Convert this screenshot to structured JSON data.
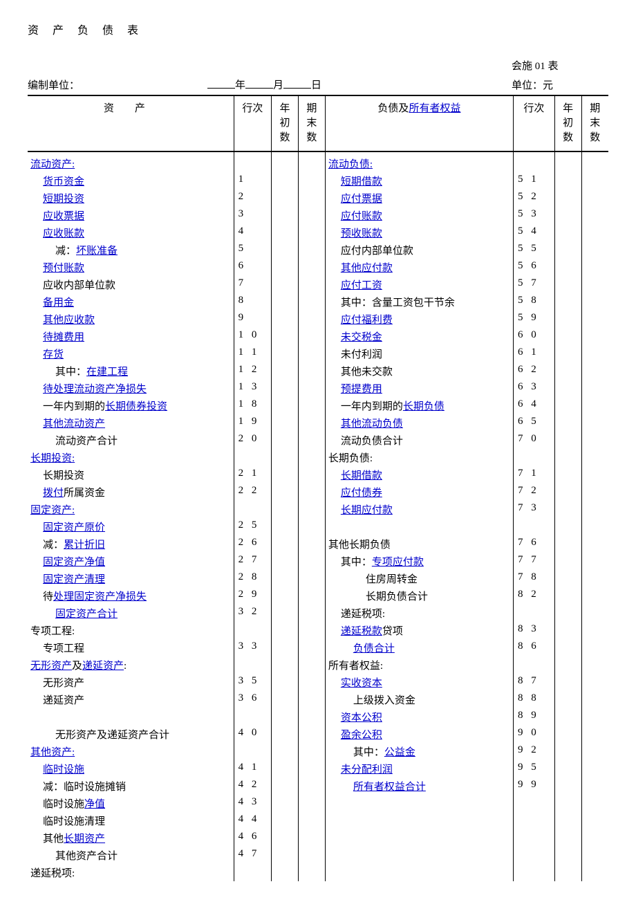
{
  "title": "资 产 负 债 表",
  "form_code": "会施 01 表",
  "org_label": "编制单位：",
  "date_year": "年",
  "date_month": "月",
  "date_day": "日",
  "unit_label": "单位：元",
  "headers": {
    "asset": "资产",
    "line": "行次",
    "begin": "年初数",
    "end": "期末数",
    "liab": "负债及",
    "owner": "所有者权益"
  },
  "rows": [
    {
      "al": "流动资产:",
      "alink": 1,
      "ln": "",
      "bl": "流动负债:",
      "blink": 1,
      "rn": ""
    },
    {
      "ai": 1,
      "al": "货币资金",
      "alink": 1,
      "ln": "1",
      "bi": 1,
      "bl": "短期借款",
      "blink": 1,
      "rn": "51"
    },
    {
      "ai": 1,
      "al": "短期投资",
      "alink": 1,
      "ln": "2",
      "bi": 1,
      "bl": "应付票据",
      "blink": 1,
      "rn": "52"
    },
    {
      "ai": 1,
      "al": "应收票据",
      "alink": 1,
      "ln": "3",
      "bi": 1,
      "bl": "应付账款",
      "blink": 1,
      "rn": "53"
    },
    {
      "ai": 1,
      "al": "应收账款",
      "alink": 1,
      "ln": "4",
      "bi": 1,
      "bl": "预收账款",
      "blink": 1,
      "rn": "54"
    },
    {
      "ai": 2,
      "ap": "减：",
      "al": "坏账准备",
      "alink": 1,
      "ln": "5",
      "bi": 1,
      "bl": "应付内部单位款",
      "rn": "55"
    },
    {
      "ai": 1,
      "al": "预付账款",
      "alink": 1,
      "ln": "6",
      "bi": 1,
      "bl": "其他应付款",
      "blink": 1,
      "rn": "56"
    },
    {
      "ai": 1,
      "al": "应收内部单位款",
      "ln": "7",
      "bi": 1,
      "bl": "应付工资",
      "blink": 1,
      "rn": "57"
    },
    {
      "ai": 1,
      "al": "备用金",
      "alink": 1,
      "ln": "8",
      "bi": 1,
      "bl": "其中：含量工资包干节余",
      "rn": "58"
    },
    {
      "ai": 1,
      "al": "其他应收款",
      "alink": 1,
      "ln": "9",
      "bi": 1,
      "bl": "应付福利费",
      "blink": 1,
      "rn": "59"
    },
    {
      "ai": 1,
      "al": "待摊费用",
      "alink": 1,
      "ln": "10",
      "bi": 1,
      "bl": "未交税金",
      "blink": 1,
      "rn": "60"
    },
    {
      "ai": 1,
      "al": "存货",
      "alink": 1,
      "ln": "11",
      "bi": 1,
      "bl": "未付利润",
      "rn": "61"
    },
    {
      "ai": 2,
      "ap": "其中：",
      "al": "在建工程",
      "alink": 1,
      "ln": "12",
      "bi": 1,
      "bl": "其他未交款",
      "rn": "62"
    },
    {
      "ai": 1,
      "al": "待处理流动资产净损失",
      "alink": 1,
      "ln": "13",
      "bi": 1,
      "bl": "预提费用",
      "blink": 1,
      "rn": "63"
    },
    {
      "ai": 1,
      "ap": "一年内到期的",
      "al": "长期债券投资",
      "alink": 1,
      "ln": "18",
      "bi": 1,
      "bp": "一年内到期的",
      "bl": "长期负债",
      "blink": 1,
      "rn": "64"
    },
    {
      "ai": 1,
      "al": "其他流动资产",
      "alink": 1,
      "ln": "19",
      "bi": 1,
      "bl": "其他流动负债",
      "blink": 1,
      "rn": "65"
    },
    {
      "ai": 2,
      "al": "流动资产合计",
      "ln": "20",
      "bi": 1,
      "bl": "流动负债合计",
      "rn": "70"
    },
    {
      "al": "长期投资:",
      "alink": 1,
      "ln": "",
      "bl": "长期负债:",
      "rn": ""
    },
    {
      "ai": 1,
      "al": "长期投资",
      "ln": "21",
      "bi": 1,
      "bl": "长期借款",
      "blink": 1,
      "rn": "71"
    },
    {
      "ai": 1,
      "al": "拨付",
      "alink": 1,
      "as": "所属资金",
      "ln": "22",
      "bi": 1,
      "bl": "应付债券",
      "blink": 1,
      "rn": "72"
    },
    {
      "al": "固定资产:",
      "alink": 1,
      "ln": "",
      "bi": 1,
      "bl": "长期应付款",
      "blink": 1,
      "rn": "73"
    },
    {
      "ai": 1,
      "al": "固定资产原价",
      "alink": 1,
      "ln": "25",
      "bl": "",
      "rn": ""
    },
    {
      "ai": 1,
      "ap": "减：",
      "al": "累计折旧",
      "alink": 1,
      "ln": "26",
      "bl": "其他长期负债",
      "rn": "76"
    },
    {
      "ai": 1,
      "al": "固定资产净值",
      "alink": 1,
      "ln": "27",
      "bi": 1,
      "bp": "其中：",
      "bl": "专项应付款",
      "blink": 1,
      "rn": "77"
    },
    {
      "ai": 1,
      "al": "固定资产清理",
      "alink": 1,
      "ln": "28",
      "bi": 3,
      "bl": "住房周转金",
      "rn": "78"
    },
    {
      "ai": 1,
      "ap": "待",
      "al": "处理固定资产净损失",
      "alink": 1,
      "ln": "29",
      "bi": 3,
      "bl": "长期负债合计",
      "rn": "82"
    },
    {
      "ai": 2,
      "al": "固定资产合计",
      "alink": 1,
      "ln": "32",
      "bi": 1,
      "bl": "递延税项:",
      "rn": ""
    },
    {
      "al": "专项工程:",
      "ln": "",
      "bi": 1,
      "bl": "递延税款",
      "blink": 1,
      "bs": "贷项",
      "rn": "83"
    },
    {
      "ai": 1,
      "al": "专项工程",
      "ln": "33",
      "bi": 2,
      "bl": "负债合计",
      "blink": 1,
      "rn": "86"
    },
    {
      "al": "无形资产",
      "alink": 1,
      "as": "及",
      "al2": "递延资产",
      "alink2": 1,
      "as2": ":",
      "ln": "",
      "bl": "所有者权益:",
      "rn": ""
    },
    {
      "ai": 1,
      "al": "无形资产",
      "ln": "35",
      "bi": 1,
      "bl": "实收资本",
      "blink": 1,
      "rn": "87"
    },
    {
      "ai": 1,
      "al": "递延资产",
      "ln": "36",
      "bi": 2,
      "bl": "上级拨入资金",
      "rn": "88"
    },
    {
      "al": "",
      "ln": "",
      "bi": 1,
      "bl": "资本公积",
      "blink": 1,
      "rn": "89"
    },
    {
      "ai": 2,
      "al": "无形资产及递延资产合计",
      "ln": "40",
      "bi": 1,
      "bl": "盈余公积",
      "blink": 1,
      "rn": "90"
    },
    {
      "al": "其他资产:",
      "alink": 1,
      "ln": "",
      "bi": 2,
      "bp": "其中：",
      "bl": "公益金",
      "blink": 1,
      "rn": "92"
    },
    {
      "ai": 1,
      "al": "临时设施",
      "alink": 1,
      "ln": "41",
      "bi": 1,
      "bl": "未分配利润",
      "blink": 1,
      "rn": "95"
    },
    {
      "ai": 1,
      "al": "减：临时设施摊销",
      "ln": "42",
      "bi": 2,
      "bl": "所有者权益合计",
      "blink": 1,
      "rn": "99"
    },
    {
      "ai": 1,
      "ap": "临时设施",
      "al": "净值",
      "alink": 1,
      "ln": "43",
      "bl": "",
      "rn": ""
    },
    {
      "ai": 1,
      "al": "临时设施清理",
      "ln": "44",
      "bl": "",
      "rn": ""
    },
    {
      "ai": 1,
      "ap": "其他",
      "al": "长期资产",
      "alink": 1,
      "ln": "46",
      "bl": "",
      "rn": ""
    },
    {
      "ai": 2,
      "al": "其他资产合计",
      "ln": "47",
      "bl": "",
      "rn": ""
    },
    {
      "al": "递延税项:",
      "ln": "",
      "bl": "",
      "rn": ""
    }
  ]
}
